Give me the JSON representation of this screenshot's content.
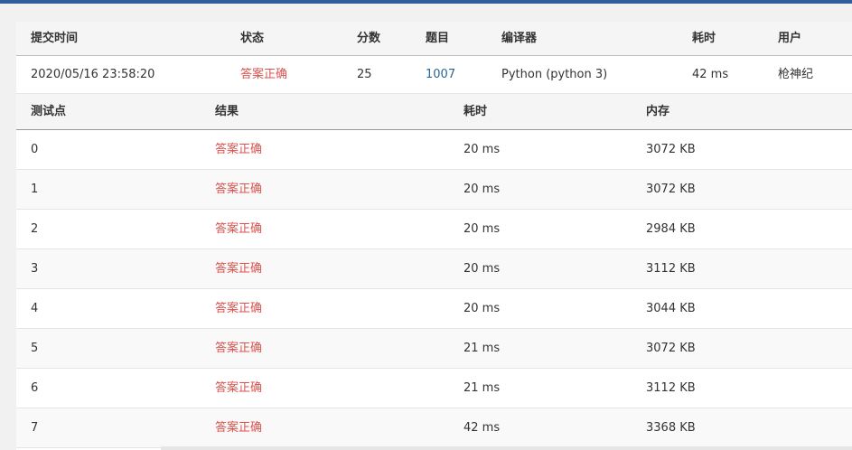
{
  "summary": {
    "headers": {
      "submit_time": "提交时间",
      "status": "状态",
      "score": "分数",
      "problem": "题目",
      "compiler": "编译器",
      "time": "耗时",
      "user": "用户"
    },
    "row": {
      "submit_time": "2020/05/16 23:58:20",
      "status": "答案正确",
      "score": "25",
      "problem": "1007",
      "compiler": "Python (python 3)",
      "time": "42 ms",
      "user": "枪神纪"
    }
  },
  "details": {
    "headers": {
      "test_case": "测试点",
      "result": "结果",
      "time": "耗时",
      "memory": "内存"
    },
    "rows": [
      {
        "test_case": "0",
        "result": "答案正确",
        "time": "20 ms",
        "memory": "3072 KB"
      },
      {
        "test_case": "1",
        "result": "答案正确",
        "time": "20 ms",
        "memory": "3072 KB"
      },
      {
        "test_case": "2",
        "result": "答案正确",
        "time": "20 ms",
        "memory": "2984 KB"
      },
      {
        "test_case": "3",
        "result": "答案正确",
        "time": "20 ms",
        "memory": "3112 KB"
      },
      {
        "test_case": "4",
        "result": "答案正确",
        "time": "20 ms",
        "memory": "3044 KB"
      },
      {
        "test_case": "5",
        "result": "答案正确",
        "time": "21 ms",
        "memory": "3072 KB"
      },
      {
        "test_case": "6",
        "result": "答案正确",
        "time": "21 ms",
        "memory": "3112 KB"
      },
      {
        "test_case": "7",
        "result": "答案正确",
        "time": "42 ms",
        "memory": "3368 KB"
      }
    ]
  },
  "colors": {
    "accent": "#2f5c9a",
    "status_ok": "#d9534f",
    "link": "#2a6496"
  }
}
